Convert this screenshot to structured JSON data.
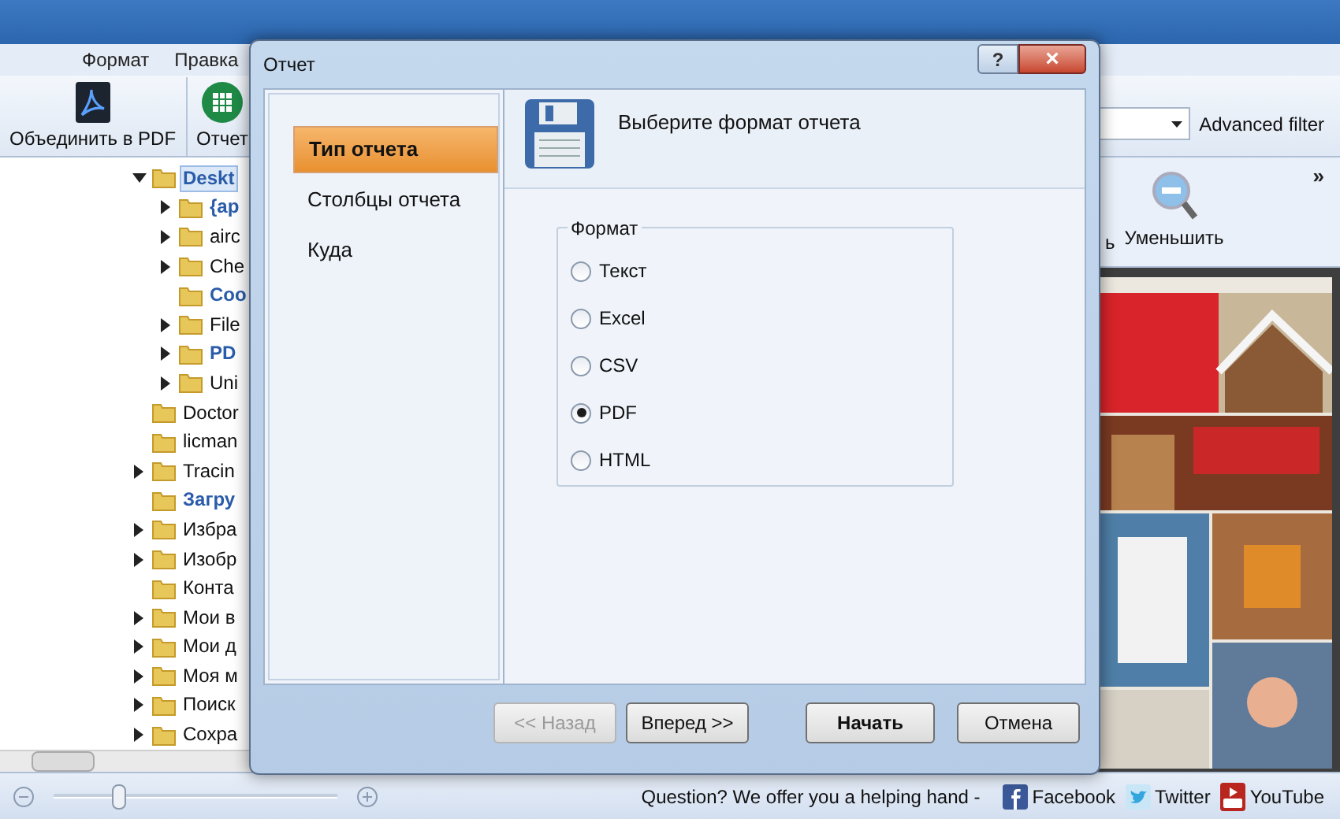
{
  "menu": [
    "Формат",
    "Правка"
  ],
  "toolbar": [
    {
      "label": "Объединить в PDF",
      "kind": "pdf"
    },
    {
      "label": "Отчет",
      "kind": "report"
    }
  ],
  "filter": {
    "label": "Advanced filter"
  },
  "tree": [
    {
      "label": "Deskt",
      "expanded": true,
      "emphasized": true,
      "selected": true,
      "children": [
        {
          "label": "{ap",
          "expanded": false,
          "emphasized": true,
          "selected": false
        },
        {
          "label": "airc",
          "expanded": false,
          "emphasized": false,
          "selected": false
        },
        {
          "label": "Che",
          "expanded": false,
          "emphasized": false,
          "selected": false
        },
        {
          "label": "Coo",
          "emphasized": true,
          "selected": false
        },
        {
          "label": "File",
          "expanded": false,
          "emphasized": false,
          "selected": false
        },
        {
          "label": "PD",
          "expanded": false,
          "emphasized": true,
          "selected": false
        },
        {
          "label": "Uni",
          "expanded": false,
          "emphasized": false,
          "selected": false
        }
      ]
    },
    {
      "label": "Doctor",
      "emphasized": false,
      "selected": false
    },
    {
      "label": "licman",
      "emphasized": false,
      "selected": false
    },
    {
      "label": "Tracin",
      "expanded": false,
      "emphasized": false,
      "selected": false
    },
    {
      "label": "Загру",
      "emphasized": true,
      "selected": false
    },
    {
      "label": "Избра",
      "expanded": false,
      "emphasized": false,
      "selected": false
    },
    {
      "label": "Изобр",
      "expanded": false,
      "emphasized": false,
      "selected": false
    },
    {
      "label": "Конта",
      "emphasized": false,
      "selected": false
    },
    {
      "label": "Мои в",
      "expanded": false,
      "emphasized": false,
      "selected": false
    },
    {
      "label": "Мои д",
      "expanded": false,
      "emphasized": false,
      "selected": false
    },
    {
      "label": "Моя м",
      "expanded": false,
      "emphasized": false,
      "selected": false
    },
    {
      "label": "Поиск",
      "expanded": false,
      "emphasized": false,
      "selected": false
    },
    {
      "label": "Сохра",
      "expanded": false,
      "emphasized": false,
      "selected": false
    }
  ],
  "view_toolbar": {
    "cut_label": "ь",
    "zoom_out": "Уменьшить",
    "more": "»"
  },
  "preview": {
    "kind": "picture"
  },
  "status_bar": {
    "zoom": {
      "level": 0.23
    },
    "help_text": "Question? We offer you a helping hand -",
    "links": [
      {
        "label": "Facebook",
        "kind": "facebook"
      },
      {
        "label": "Twitter",
        "kind": "twitter"
      },
      {
        "label": "YouTube",
        "kind": "youtube"
      }
    ]
  },
  "dialog": {
    "title": "Отчет",
    "help": "?",
    "close": "×",
    "steps": [
      {
        "label": "Тип отчета",
        "selected": true
      },
      {
        "label": "Столбцы отчета",
        "selected": false
      },
      {
        "label": "Куда",
        "selected": false
      }
    ],
    "heading": "Выберите формат отчета",
    "group_title": "Формат",
    "formats": [
      {
        "label": "Текст",
        "selected": false
      },
      {
        "label": "Excel",
        "selected": false
      },
      {
        "label": "CSV",
        "selected": false
      },
      {
        "label": "PDF",
        "selected": true
      },
      {
        "label": "HTML",
        "selected": false
      }
    ],
    "buttons": [
      {
        "label": "<< Назад",
        "disabled": true,
        "primary": false
      },
      {
        "label": "Вперед >>",
        "disabled": false,
        "primary": false
      },
      {
        "label": "Начать",
        "disabled": false,
        "primary": true
      },
      {
        "label": "Отмена",
        "disabled": false,
        "primary": false
      }
    ]
  }
}
